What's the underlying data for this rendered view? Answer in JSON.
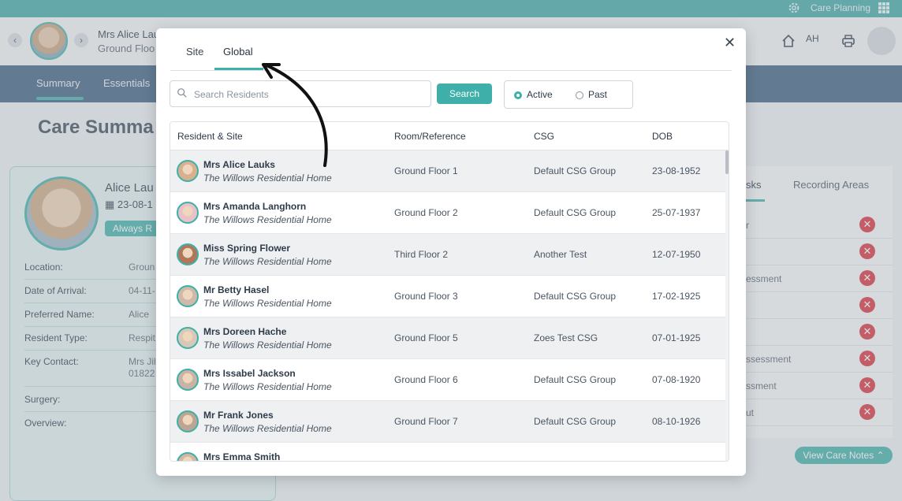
{
  "topbar": {
    "app_label": "Care Planning",
    "icons": [
      "gear-icon",
      "app-grid-icon"
    ]
  },
  "header": {
    "resident_name": "Mrs Alice Lau",
    "resident_location": "Ground Floo",
    "user_initials": "AH",
    "icons": [
      "chevron-left-icon",
      "chevron-right-icon",
      "home-icon",
      "printer-icon",
      "user-avatar"
    ]
  },
  "nav": {
    "tabs": [
      "Summary",
      "Essentials"
    ],
    "active": "Summary"
  },
  "background": {
    "page_title": "Care Summa",
    "profile": {
      "name": "Alice Lau",
      "dob": "23-08-1",
      "badge": "Always R",
      "fields": [
        {
          "label": "Location:",
          "value": "Groun"
        },
        {
          "label": "Date of Arrival:",
          "value": "04-11-"
        },
        {
          "label": "Preferred Name:",
          "value": "Alice"
        },
        {
          "label": "Resident Type:",
          "value": "Respit"
        },
        {
          "label": "Key Contact:",
          "value": "Mrs Jil",
          "value2": "01822 "
        },
        {
          "label": "Surgery:",
          "value": ""
        },
        {
          "label": "Overview:",
          "value": ""
        }
      ]
    },
    "right_panel": {
      "tabs": [
        "sks",
        "Recording Areas"
      ],
      "rows": [
        "r",
        "",
        "essment",
        "",
        "",
        "ssessment",
        "ssment",
        "ut"
      ]
    },
    "view_notes_label": "View Care Notes"
  },
  "modal": {
    "tabs": [
      "Site",
      "Global"
    ],
    "active_tab": "Global",
    "search_placeholder": "Search Residents",
    "search_value": "",
    "search_button": "Search",
    "filter": {
      "options": [
        "Active",
        "Past"
      ],
      "selected": "Active"
    },
    "columns": [
      "Resident & Site",
      "Room/Reference",
      "CSG",
      "DOB"
    ],
    "rows": [
      {
        "name": "Mrs Alice Lauks",
        "site": "The Willows Residential Home",
        "room": "Ground Floor 1",
        "csg": "Default CSG Group",
        "dob": "23-08-1952"
      },
      {
        "name": "Mrs Amanda Langhorn",
        "site": "The Willows Residential Home",
        "room": "Ground Floor 2",
        "csg": "Default CSG Group",
        "dob": "25-07-1937"
      },
      {
        "name": "Miss Spring Flower",
        "site": "The Willows Residential Home",
        "room": "Third Floor 2",
        "csg": "Another Test",
        "dob": "12-07-1950"
      },
      {
        "name": "Mr Betty Hasel",
        "site": "The Willows Residential Home",
        "room": "Ground Floor 3",
        "csg": "Default CSG Group",
        "dob": "17-02-1925"
      },
      {
        "name": "Mrs Doreen Hache",
        "site": "The Willows Residential Home",
        "room": "Ground Floor 5",
        "csg": "Zoes Test CSG",
        "dob": "07-01-1925"
      },
      {
        "name": "Mrs Issabel Jackson",
        "site": "The Willows Residential Home",
        "room": "Ground Floor 6",
        "csg": "Default CSG Group",
        "dob": "07-08-1920"
      },
      {
        "name": "Mr Frank Jones",
        "site": "The Willows Residential Home",
        "room": "Ground Floor 7",
        "csg": "Default CSG Group",
        "dob": "08-10-1926"
      },
      {
        "name": "Mrs Emma Smith",
        "site": "",
        "room": "",
        "csg": "",
        "dob": ""
      }
    ],
    "close_icon": "close-icon"
  },
  "colors": {
    "accent": "#3fb0a9",
    "nav": "#3c5f80",
    "danger": "#d9303b"
  }
}
